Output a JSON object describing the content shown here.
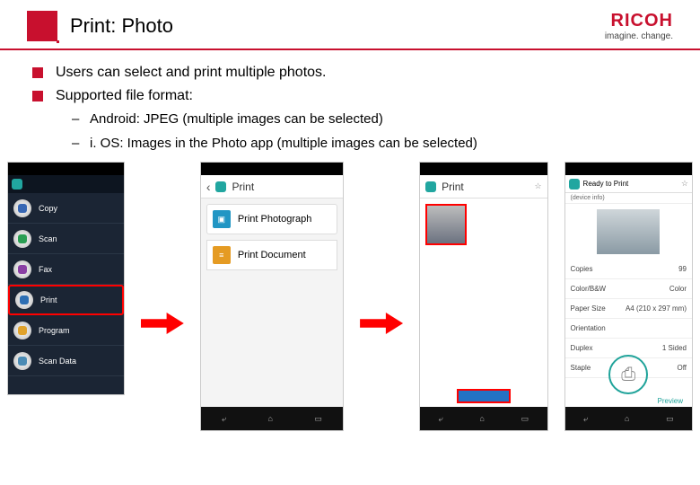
{
  "header": {
    "title": "Print: Photo",
    "brand": "RICOH",
    "tagline": "imagine. change."
  },
  "bullets": [
    "Users can select and print multiple photos.",
    "Supported file format:"
  ],
  "subbullets": [
    "Android: JPEG (multiple images can be selected)",
    "i. OS: Images in the Photo app (multiple images can be selected)"
  ],
  "shot1": {
    "menu": [
      "Copy",
      "Scan",
      "Fax",
      "Print",
      "Program",
      "Scan Data"
    ]
  },
  "shot2": {
    "title": "Print",
    "row1": "Print Photograph",
    "row2": "Print Document"
  },
  "shot3": {
    "app": "Print"
  },
  "shot4": {
    "app": "Ready to Print",
    "device": "(device info)",
    "rows": [
      {
        "k": "Copies",
        "v": "99"
      },
      {
        "k": "Color/B&W",
        "v": "Color"
      },
      {
        "k": "Paper Size",
        "v": "A4 (210 x 297 mm)"
      },
      {
        "k": "Orientation",
        "v": ""
      },
      {
        "k": "Duplex",
        "v": "1 Sided"
      },
      {
        "k": "Staple",
        "v": "Off"
      }
    ],
    "preview": "Preview"
  }
}
